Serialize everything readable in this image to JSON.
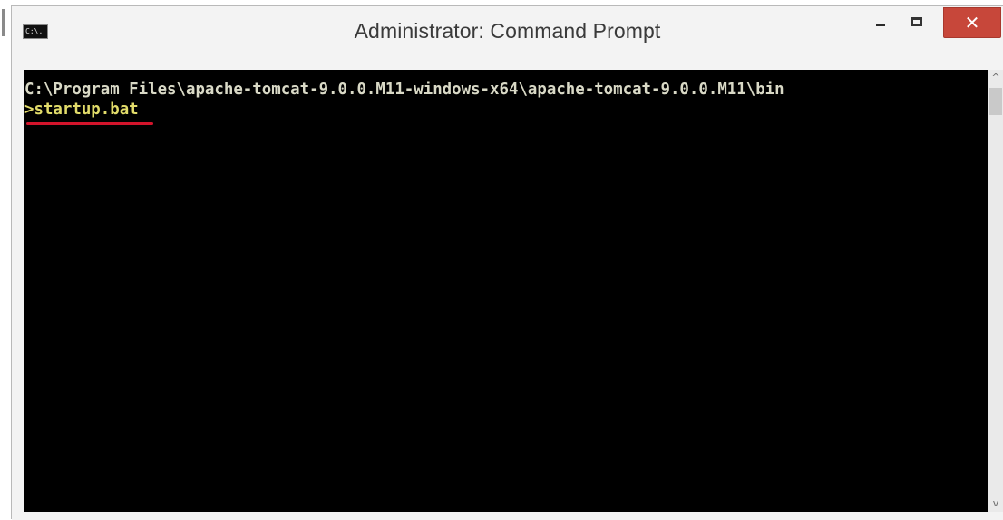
{
  "window": {
    "title": "Administrator: Command Prompt",
    "icon_label": "C:\\.",
    "controls": {
      "minimize_icon": "minimize-icon",
      "maximize_icon": "maximize-icon",
      "close_label": "✕"
    }
  },
  "console": {
    "lines": [
      "C:\\Program Files\\apache-tomcat-9.0.0.M11-windows-x64\\apache-tomcat-9.0.0.M11\\bin",
      ">startup.bat"
    ],
    "highlight_color": "#d3142b",
    "prompt_text_color": "#e2dc6a"
  },
  "scrollbar": {
    "up_arrow": "^",
    "down_arrow": "v"
  }
}
